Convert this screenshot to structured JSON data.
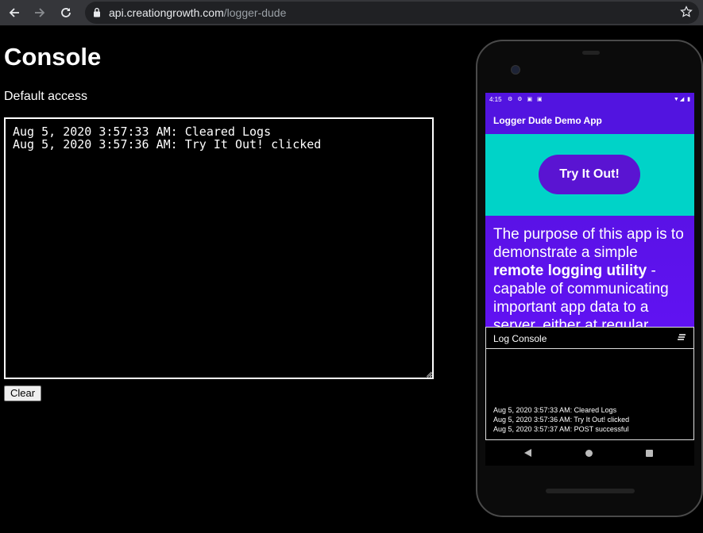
{
  "browser": {
    "url_host": "api.creationgrowth.com",
    "url_path": "/logger-dude"
  },
  "page": {
    "title": "Console",
    "access_text": "Default access",
    "log_text": "Aug 5, 2020 3:57:33 AM: Cleared Logs\nAug 5, 2020 3:57:36 AM: Try It Out! clicked",
    "clear_label": "Clear"
  },
  "phone": {
    "status_time": "4:15",
    "app_title": "Logger Dude Demo App",
    "try_button_label": "Try It Out!",
    "purpose_before": "The purpose of this app is to demonstrate a simple ",
    "purpose_bold": "remote logging utility",
    "purpose_after": " - capable of communicating important app data to a server, either at regular",
    "log_console_title": "Log Console",
    "log_lines": [
      "Aug 5, 2020 3:57:33 AM: Cleared Logs",
      "Aug 5, 2020 3:57:36 AM: Try It Out! clicked",
      "Aug 5, 2020 3:57:37 AM: POST successful"
    ]
  },
  "colors": {
    "app_bar": "#5214e0",
    "teal": "#00d3c8",
    "button": "#5a14d2"
  }
}
